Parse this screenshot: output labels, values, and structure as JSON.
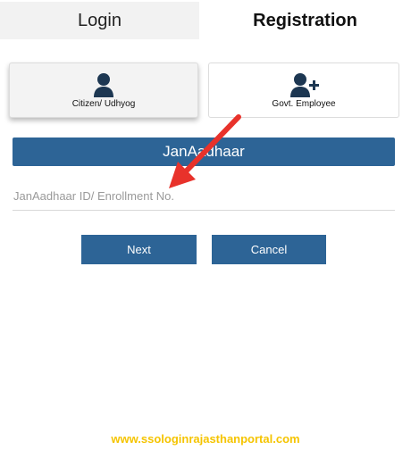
{
  "tabs": {
    "login": "Login",
    "registration": "Registration"
  },
  "cards": {
    "citizen_label": "Citizen/ Udhyog",
    "employee_label": "Govt. Employee"
  },
  "section": {
    "title": "JanAadhaar"
  },
  "form": {
    "id_value": "",
    "id_placeholder": "JanAadhaar ID/ Enrollment No."
  },
  "buttons": {
    "next": "Next",
    "cancel": "Cancel"
  },
  "footer": {
    "url": "www.ssologinrajasthanportal.com"
  },
  "colors": {
    "primary": "#2d6496",
    "annotation_arrow": "#e8322b",
    "footer_text": "#f5c400"
  },
  "icons": {
    "citizen": "user-icon",
    "employee": "user-add-icon",
    "annotation": "arrow-icon"
  }
}
